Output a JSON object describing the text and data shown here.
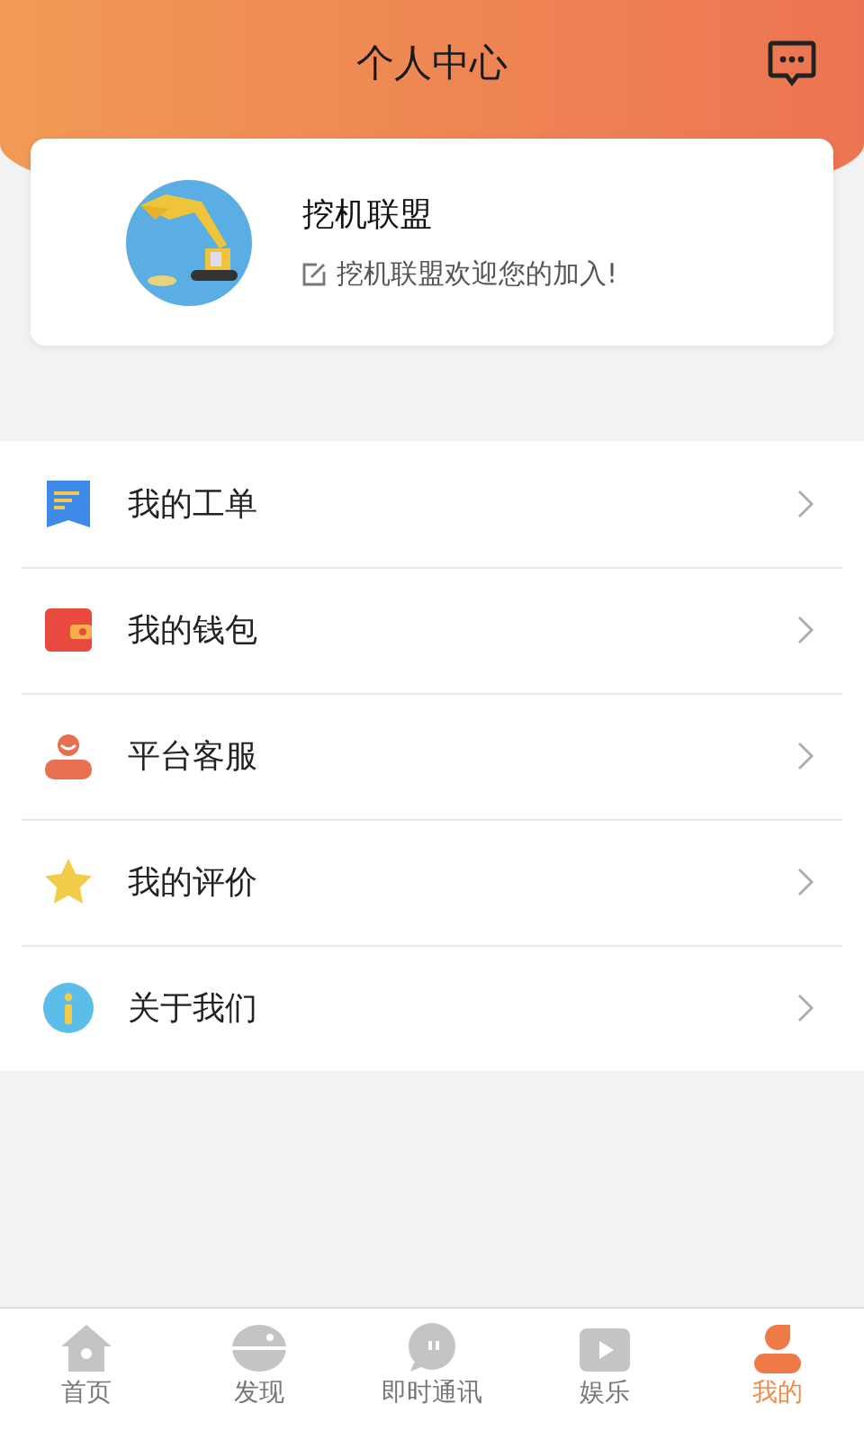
{
  "header": {
    "title": "个人中心"
  },
  "profile": {
    "name": "挖机联盟",
    "motto": "挖机联盟欢迎您的加入!"
  },
  "menu": [
    {
      "kind": "orders",
      "label": "我的工单"
    },
    {
      "kind": "wallet",
      "label": "我的钱包"
    },
    {
      "kind": "service",
      "label": "平台客服"
    },
    {
      "kind": "reviews",
      "label": "我的评价"
    },
    {
      "kind": "about",
      "label": "关于我们"
    }
  ],
  "tabs": [
    {
      "kind": "home",
      "label": "首页",
      "selected": false
    },
    {
      "kind": "discover",
      "label": "发现",
      "selected": false
    },
    {
      "kind": "chat",
      "label": "即时通讯",
      "selected": false
    },
    {
      "kind": "media",
      "label": "娱乐",
      "selected": false
    },
    {
      "kind": "me",
      "label": "我的",
      "selected": true
    }
  ]
}
